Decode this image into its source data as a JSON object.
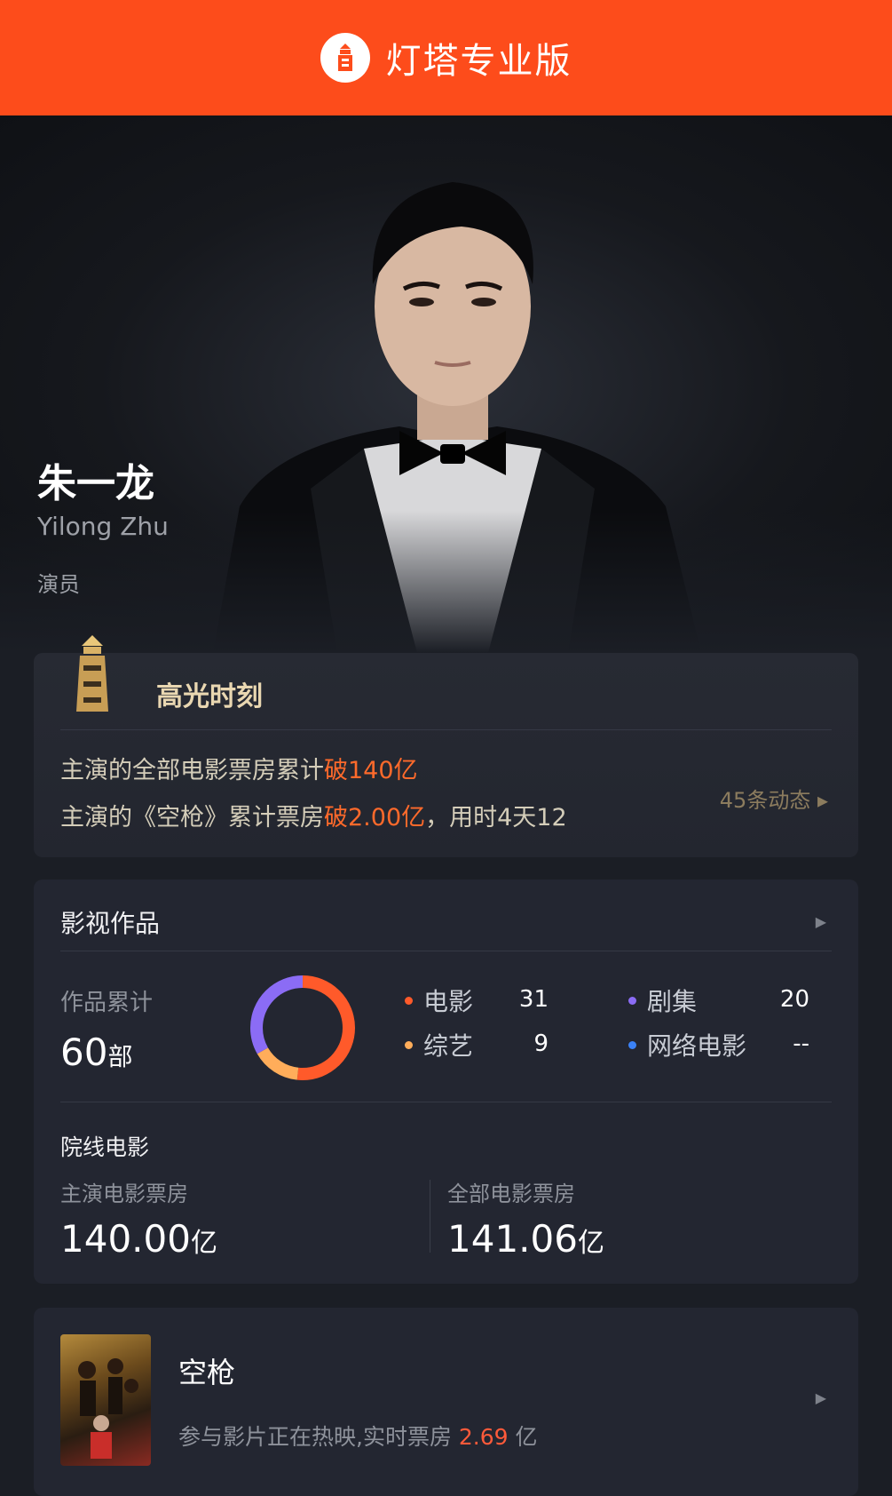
{
  "header": {
    "app_title": "灯塔专业版"
  },
  "profile": {
    "name": "朱一龙",
    "name_en": "Yilong Zhu",
    "role": "演员"
  },
  "highlight": {
    "title": "高光时刻",
    "line1_prefix": "主演的全部电影票房累计",
    "line1_em": "破140亿",
    "line2_prefix": "主演的《空枪》累计票房",
    "line2_em": "破2.00亿",
    "line2_suffix": "，用时4天12",
    "more": "45条动态 ▸"
  },
  "works": {
    "title": "影视作品",
    "count_label": "作品累计",
    "count_value": "60",
    "count_unit": "部",
    "categories": [
      {
        "label": "电影",
        "count": "31",
        "color": "#ff5a2a"
      },
      {
        "label": "剧集",
        "count": "20",
        "color": "#8b6cf5"
      },
      {
        "label": "综艺",
        "count": "9",
        "color": "#ffad5a"
      },
      {
        "label": "网络电影",
        "count": "--",
        "color": "#3b82f6"
      }
    ],
    "theater_title": "院线电影",
    "lead_label": "主演电影票房",
    "lead_value": "140.00",
    "lead_unit": "亿",
    "all_label": "全部电影票房",
    "all_value": "141.06",
    "all_unit": "亿"
  },
  "movie": {
    "title": "空枪",
    "status_prefix": "参与影片正在热映,实时票房",
    "status_value": "2.69",
    "status_unit": "亿"
  }
}
